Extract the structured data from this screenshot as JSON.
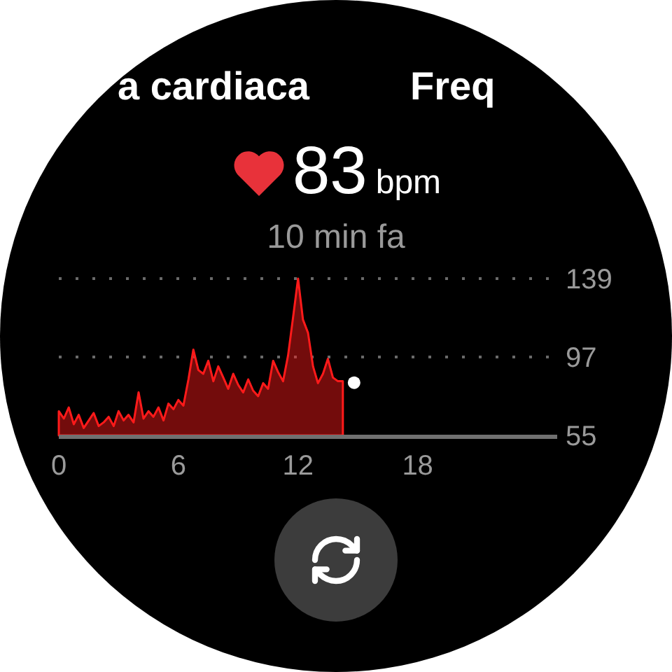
{
  "titles": [
    "a cardiaca",
    "Freq"
  ],
  "reading": {
    "value": "83",
    "unit": "bpm",
    "time": "10 min fa"
  },
  "chart_data": {
    "type": "area",
    "xlim": [
      0,
      25
    ],
    "ylim": [
      55,
      139
    ],
    "xticks": [
      0,
      6,
      12,
      18
    ],
    "yticks": [
      55,
      97,
      139
    ],
    "x": [
      0,
      0.25,
      0.5,
      0.75,
      1,
      1.25,
      1.5,
      1.75,
      2,
      2.25,
      2.5,
      2.75,
      3,
      3.25,
      3.5,
      3.75,
      4,
      4.25,
      4.5,
      4.75,
      5,
      5.25,
      5.5,
      5.75,
      6,
      6.25,
      6.5,
      6.75,
      7,
      7.25,
      7.5,
      7.75,
      8,
      8.25,
      8.5,
      8.75,
      9,
      9.25,
      9.5,
      9.75,
      10,
      10.25,
      10.5,
      10.75,
      11,
      11.25,
      11.5,
      11.75,
      12,
      12.25,
      12.5,
      12.75,
      13,
      13.25,
      13.5,
      13.75,
      14,
      14.25
    ],
    "series": [
      {
        "color": "#ff1a1a",
        "values": [
          68,
          64,
          70,
          61,
          66,
          59,
          63,
          67,
          60,
          62,
          65,
          60,
          68,
          63,
          66,
          62,
          78,
          64,
          68,
          65,
          70,
          63,
          72,
          69,
          74,
          71,
          85,
          101,
          90,
          88,
          95,
          84,
          92,
          86,
          80,
          88,
          82,
          78,
          85,
          79,
          76,
          83,
          80,
          95,
          89,
          84,
          98,
          118,
          139,
          117,
          110,
          92,
          83,
          88,
          96,
          86,
          84,
          84
        ]
      }
    ]
  }
}
